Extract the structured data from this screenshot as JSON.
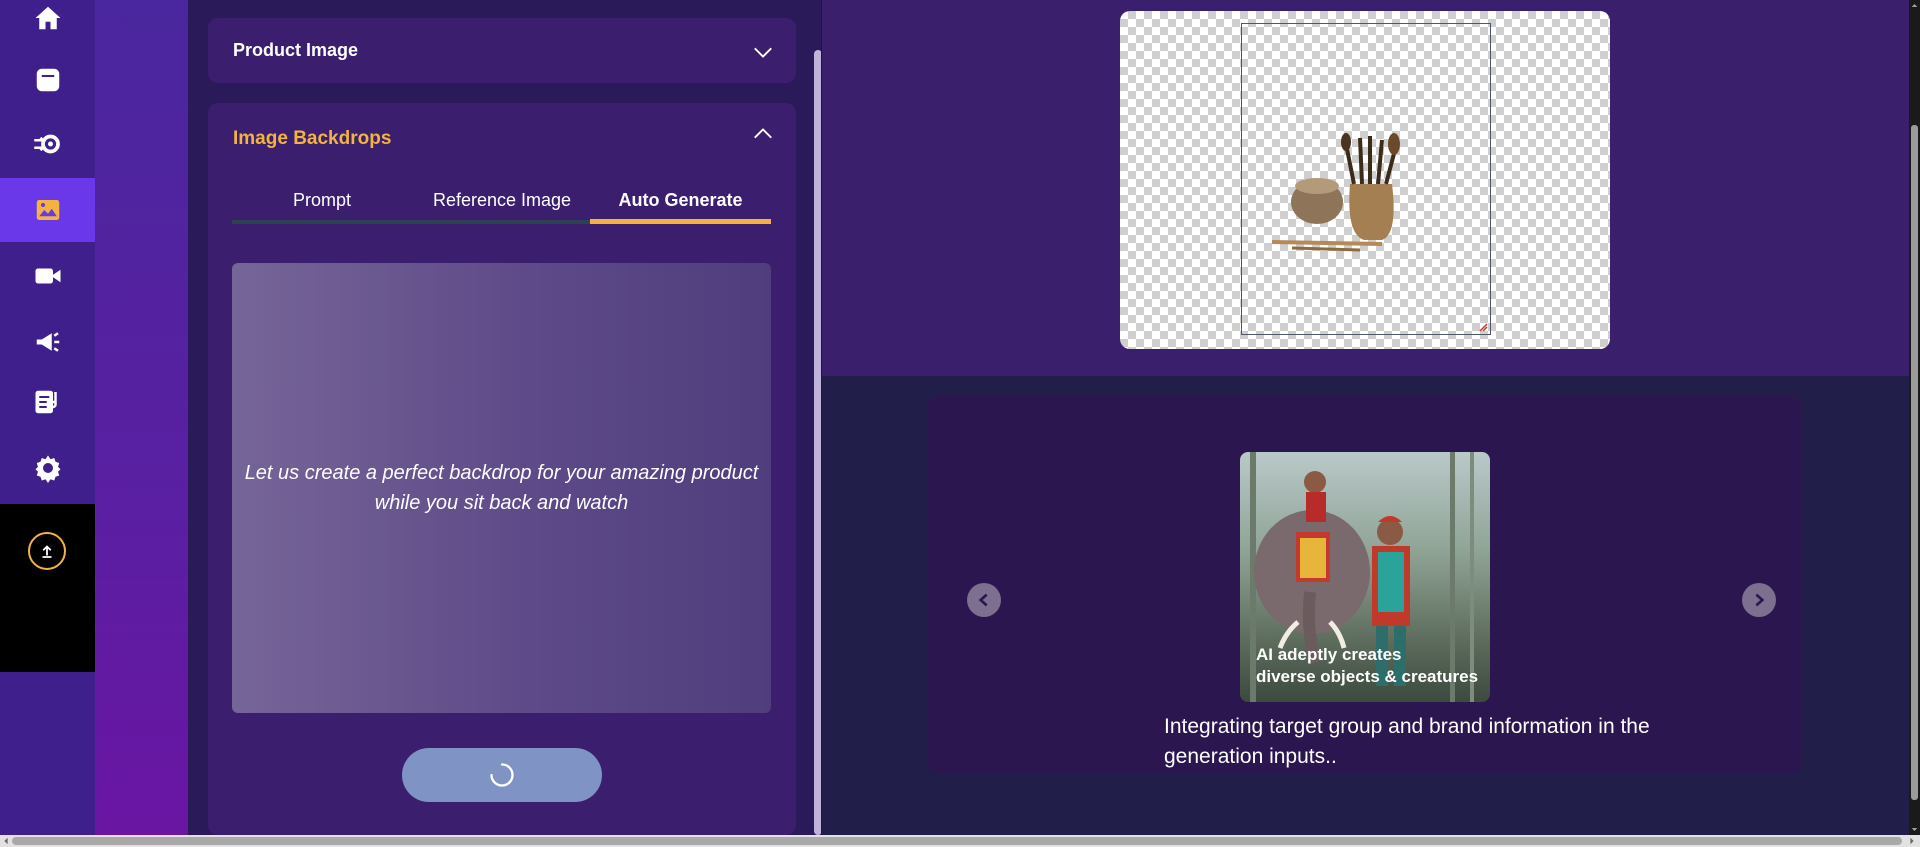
{
  "sidebar": {
    "items": [
      {
        "icon": "home-icon"
      },
      {
        "icon": "square-icon"
      },
      {
        "icon": "settings-gear-arrow-icon"
      },
      {
        "icon": "image-icon",
        "active": true
      },
      {
        "icon": "video-camera-icon"
      },
      {
        "icon": "megaphone-icon"
      },
      {
        "icon": "notes-music-icon"
      },
      {
        "icon": "gear-icon"
      }
    ],
    "upload_icon": "upload-icon"
  },
  "panel": {
    "product_image": {
      "title": "Product Image",
      "expanded": false
    },
    "image_backdrops": {
      "title": "Image Backdrops",
      "expanded": true,
      "tabs": [
        {
          "label": "Prompt",
          "active": false
        },
        {
          "label": "Reference Image",
          "active": false
        },
        {
          "label": "Auto Generate",
          "active": true
        }
      ],
      "auto_generate_text": "Let us create a perfect backdrop for your amazing product while you sit back and watch",
      "generate_button_state": "loading"
    }
  },
  "canvas": {
    "background": "transparent-checkerboard",
    "product": "kitchen utensils and pot"
  },
  "carousel": {
    "slide_caption_line1": "AI adeptly creates",
    "slide_caption_line2": "diverse objects & creatures",
    "description": "Integrating target group and brand information in the generation inputs.."
  },
  "colors": {
    "accent": "#f2b340",
    "active_rail": "#6a38e8",
    "panel_bg": "#2a1a5a",
    "accordion_bg": "#3b1f6e",
    "generate_button": "#7f93c4"
  }
}
